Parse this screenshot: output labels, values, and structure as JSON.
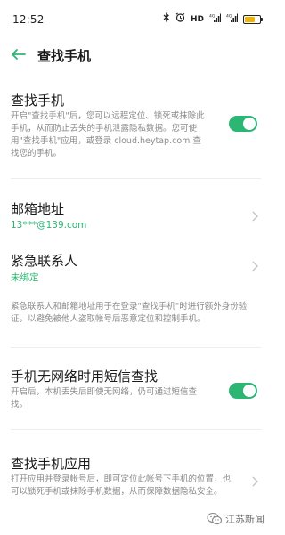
{
  "status_bar": {
    "time": "12:52",
    "icons": [
      "bluetooth-icon",
      "alarm-icon",
      "hd-icon",
      "signal-icon",
      "signal-icon",
      "battery-icon"
    ],
    "hd_label": "HD",
    "sig1": "4G",
    "sig2": "4G",
    "battery_level": 0.7
  },
  "header": {
    "title": "查找手机"
  },
  "find_phone": {
    "title": "查找手机",
    "desc": "开启\"查找手机\"后，您可以远程定位、锁死或抹除此手机，从而防止丢失的手机泄露隐私数据。您可使用\"查找手机\"应用，或登录 cloud.heytap.com 查找您的手机。",
    "enabled": true
  },
  "email": {
    "title": "邮箱地址",
    "value": "13***@139.com"
  },
  "emergency": {
    "title": "紧急联系人",
    "value": "未绑定",
    "note": "紧急联系人和邮箱地址用于在登录\"查找手机\"时进行额外身份验证，以避免被他人盗取帐号后恶意定位和控制手机。"
  },
  "sms_find": {
    "title": "手机无网络时用短信查找",
    "desc": "开启后，本机丢失后即使无网络，仍可通过短信查找。",
    "enabled": true
  },
  "find_app": {
    "title": "查找手机应用",
    "desc": "打开应用并登录帐号后，即可定位此帐号下手机的位置，也可以锁死手机或抹除手机数据，从而保障数据隐私安全。"
  },
  "watermark": {
    "text": "江苏新闻"
  },
  "colors": {
    "accent": "#2bb673",
    "desc_gray": "#8a8a8a"
  }
}
